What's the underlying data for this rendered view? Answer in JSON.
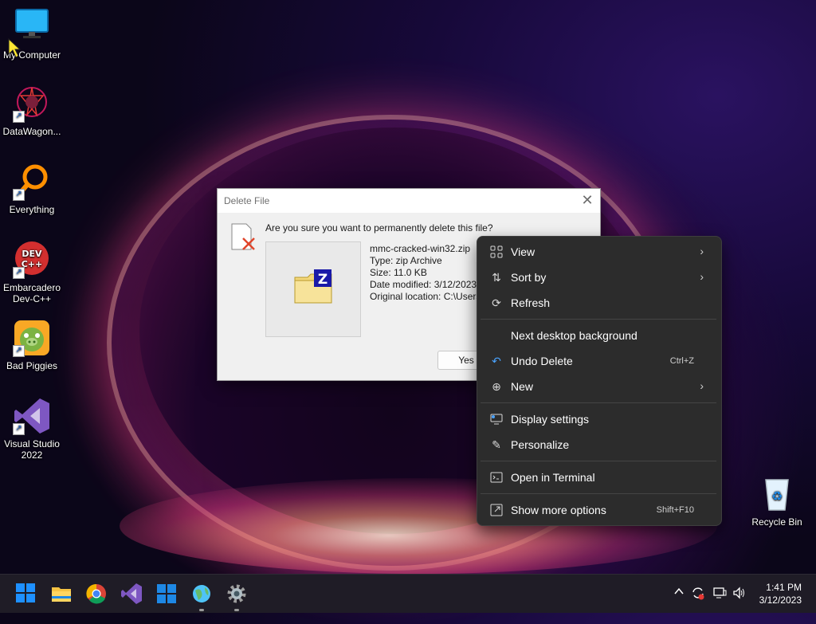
{
  "desktop": {
    "icons": [
      {
        "label": "My Computer"
      },
      {
        "label": "DataWagon..."
      },
      {
        "label": "Everything"
      },
      {
        "label": "Embarcadero Dev-C++"
      },
      {
        "label": "Bad Piggies"
      },
      {
        "label": "Visual Studio 2022"
      },
      {
        "label": "Recycle Bin"
      }
    ]
  },
  "dialog": {
    "title": "Delete File",
    "question": "Are you sure you want to permanently delete this file?",
    "file_name": "mmc-cracked-win32.zip",
    "file_type": "Type: zip Archive",
    "file_size": "Size: 11.0 KB",
    "date_modified": "Date modified: 3/12/2023",
    "original_location": "Original location: C:\\Users",
    "yes_label": "Yes"
  },
  "context_menu": {
    "items": [
      {
        "label": "View",
        "icon": "grid-icon",
        "submenu": true
      },
      {
        "label": "Sort by",
        "icon": "sort-icon",
        "submenu": true
      },
      {
        "label": "Refresh",
        "icon": "refresh-icon"
      },
      {
        "label": "Next desktop background"
      },
      {
        "label": "Undo Delete",
        "icon": "undo-icon",
        "accelerator": "Ctrl+Z"
      },
      {
        "label": "New",
        "icon": "plus-circle-icon",
        "submenu": true
      },
      {
        "label": "Display settings",
        "icon": "display-icon"
      },
      {
        "label": "Personalize",
        "icon": "brush-icon"
      },
      {
        "label": "Open in Terminal",
        "icon": "terminal-icon"
      },
      {
        "label": "Show more options",
        "icon": "expand-icon",
        "accelerator": "Shift+F10"
      }
    ]
  },
  "taskbar": {
    "apps": [
      "start",
      "file-explorer",
      "chrome",
      "visual-studio",
      "microsoft-store",
      "network-app",
      "settings"
    ],
    "clock": {
      "time": "1:41 PM",
      "date": "3/12/2023"
    }
  },
  "colors": {
    "menu_bg": "#2c2c2c",
    "taskbar_bg": "#1f1c26",
    "start_blue": "#1e90ff"
  }
}
